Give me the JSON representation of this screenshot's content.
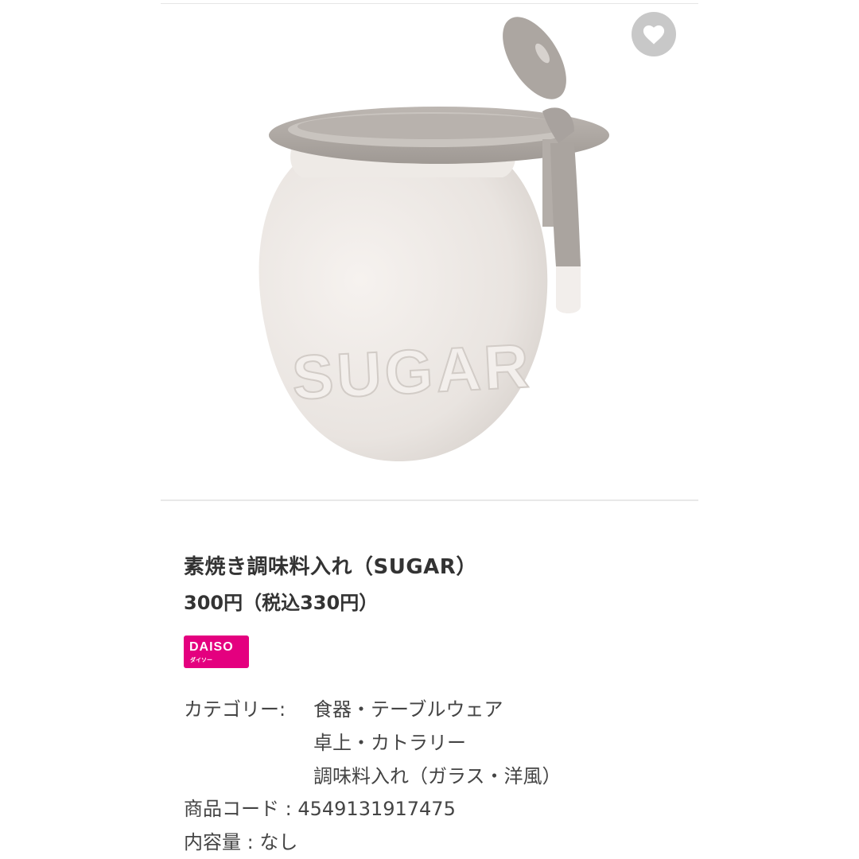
{
  "product": {
    "title": "素焼き調味料入れ（SUGAR）",
    "price": "300円（税込330円）",
    "image": {
      "jar_text": "SUGAR",
      "jar_color": "#ece7e3",
      "lid_color": "#a9a39f",
      "spoon_color": "#a8a29e"
    }
  },
  "favorite": {
    "icon": "heart-icon",
    "bg_color": "#c8c8c8"
  },
  "brand": {
    "name": "DAISO",
    "subname": "ダイソー",
    "color": "#e4007f"
  },
  "info": {
    "category_label": "カテゴリー:",
    "categories": [
      "食器・テーブルウェア",
      "卓上・カトラリー",
      "調味料入れ（ガラス・洋風）"
    ],
    "code_line": "商品コード : 4549131917475",
    "contents_line": "内容量 : なし"
  }
}
